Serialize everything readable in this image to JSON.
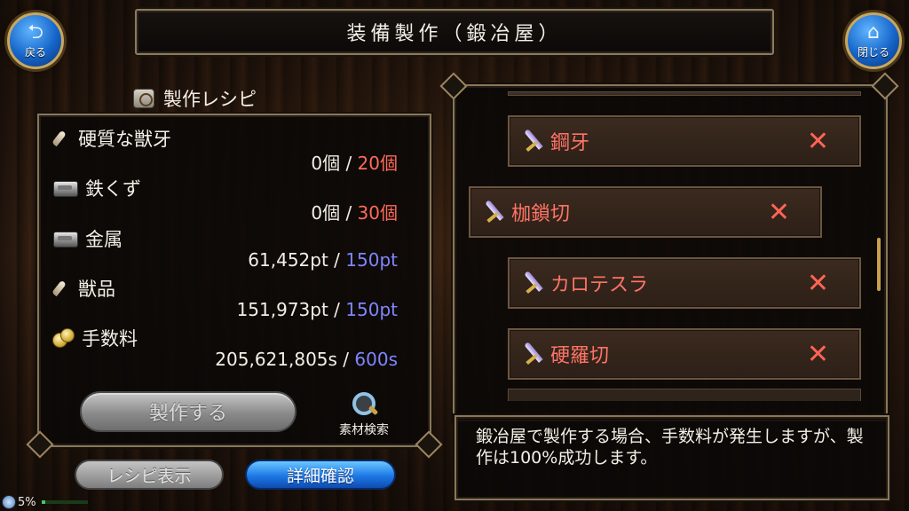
{
  "header": {
    "title": "装備製作（鍛冶屋）",
    "back_label": "戻る",
    "close_label": "閉じる"
  },
  "recipe": {
    "title": "製作レシピ",
    "materials": [
      {
        "name": "硬質な獣牙",
        "icon": "fang-icon",
        "have": "0個",
        "need": "20個",
        "need_color": "red"
      },
      {
        "name": "鉄くず",
        "icon": "ingot-icon",
        "have": "0個",
        "need": "30個",
        "need_color": "red"
      },
      {
        "name": "金属",
        "icon": "ingot-icon",
        "have": "61,452pt",
        "need": "150pt",
        "need_color": "blue"
      },
      {
        "name": "獣品",
        "icon": "fang-icon",
        "have": "151,973pt",
        "need": "150pt",
        "need_color": "blue"
      },
      {
        "name": "手数料",
        "icon": "coin-icon",
        "have": "205,621,805s",
        "need": "600s",
        "need_color": "blue"
      }
    ],
    "separator": "/",
    "craft_button": "製作する",
    "search_label": "素材検索"
  },
  "bottom_buttons": {
    "recipe_view": "レシピ表示",
    "detail_confirm": "詳細確認"
  },
  "weapon_list": [
    {
      "name": "鋼牙",
      "unavailable": "✕"
    },
    {
      "name": "枷鎖切",
      "unavailable": "✕"
    },
    {
      "name": "カロテスラ",
      "unavailable": "✕"
    },
    {
      "name": "硬羅切",
      "unavailable": "✕"
    }
  ],
  "message": "鍛冶屋で製作する場合、手数料が発生しますが、製作は100%成功します。",
  "status": {
    "battery": "5%"
  },
  "colors": {
    "need_red": "#ff6a5a",
    "need_blue": "#7f86ff",
    "item_name": "#ff7466",
    "frame": "#8a7757",
    "accent_blue": "#1e78e6"
  }
}
